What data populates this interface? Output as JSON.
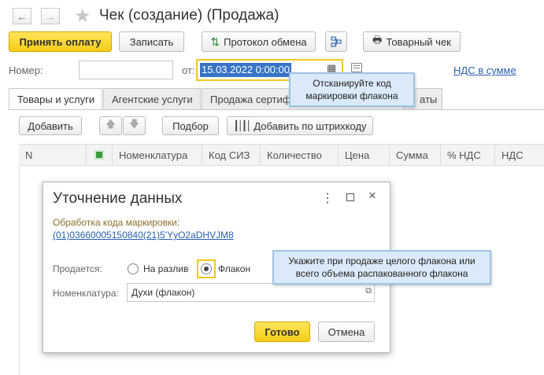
{
  "window": {
    "title": "Чек (создание) (Продажа)"
  },
  "toolbar": {
    "accept_payment": "Принять оплату",
    "save": "Записать",
    "exchange_protocol": "Протокол обмена",
    "receipt": "Товарный чек"
  },
  "header": {
    "number_label": "Номер:",
    "number_value": "",
    "from_label": "от:",
    "date_value": "15.03.2022  0:00:00",
    "vat_link": "НДС в сумме"
  },
  "tabs": [
    {
      "label": "Товары и услуги"
    },
    {
      "label": "Агентские услуги"
    },
    {
      "label": "Продажа сертиф"
    },
    {
      "label": "аты"
    }
  ],
  "goods_toolbar": {
    "add": "Добавить",
    "select": "Подбор",
    "add_barcode": "Добавить по штрихкоду"
  },
  "table": {
    "columns": [
      "N",
      "Номенклатура",
      "Код СИЗ",
      "Количество",
      "Цена",
      "Сумма",
      "% НДС",
      "НДС"
    ]
  },
  "tooltip_scan": {
    "line1": "Отсканируйте код",
    "line2": "маркировки флакона"
  },
  "dialog": {
    "title": "Уточнение данных",
    "processing_label": "Обработка кода маркировки:",
    "marking_code": "(01)03660005150840(21)5'YyO2aDHVJM8",
    "sold_label": "Продается:",
    "option_bulk": "На разлив",
    "option_bottle": "Флакон",
    "nomenclature_label": "Номенклатура:",
    "nomenclature_value": "Духи (флакон)",
    "ok": "Готово",
    "cancel": "Отмена"
  },
  "tooltip_bottle": {
    "line1": "Укажите при продаже целого флакона или",
    "line2": "всего объема распакованного флакона"
  },
  "colors": {
    "accent_yellow": "#f5cd16",
    "link_blue": "#2a5fb0",
    "tooltip_blue": "#daeaf8"
  }
}
